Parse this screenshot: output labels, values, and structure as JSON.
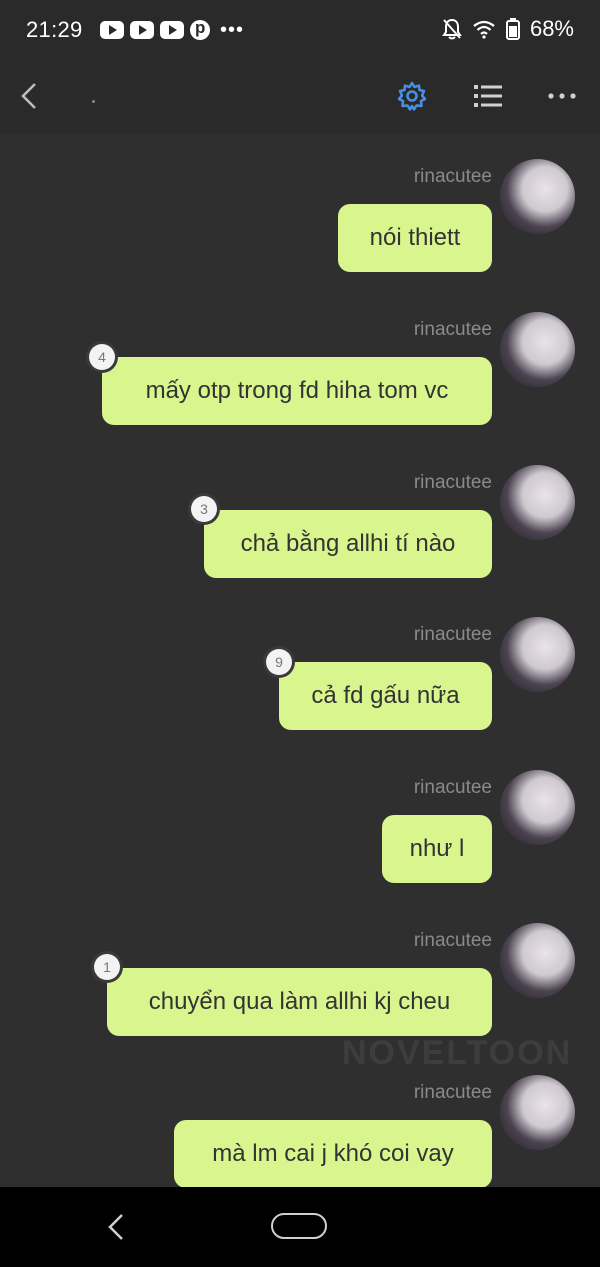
{
  "status_bar": {
    "time": "21:29",
    "battery": "68%",
    "notification_icons": [
      "youtube-icon",
      "youtube-icon",
      "youtube-icon",
      "pinterest-icon",
      "more-dots-icon"
    ],
    "right_icons": [
      "bell-muted-icon",
      "wifi-icon",
      "battery-icon"
    ]
  },
  "top_bar": {
    "icons": [
      "back-arrow-icon",
      "gear-icon",
      "list-icon",
      "more-horizontal-icon"
    ],
    "accent": "#4a90e2"
  },
  "messages": [
    {
      "sender": "rinacutee",
      "text": "nói thiett",
      "badge": ""
    },
    {
      "sender": "rinacutee",
      "text": "mấy otp trong fd hiha tom vc",
      "badge": "4"
    },
    {
      "sender": "rinacutee",
      "text": "chả bằng allhi tí nào",
      "badge": "3"
    },
    {
      "sender": "rinacutee",
      "text": "cả fd gấu nữa",
      "badge": "9"
    },
    {
      "sender": "rinacutee",
      "text": "như l",
      "badge": ""
    },
    {
      "sender": "rinacutee",
      "text": "chuyển qua làm allhi kj cheu",
      "badge": "1"
    },
    {
      "sender": "rinacutee",
      "text": "mà lm cai j khó coi vay",
      "badge": ""
    }
  ],
  "watermark": "NOVELTOON",
  "colors": {
    "bubble": "#d9f58d",
    "background": "#2f2f2f",
    "bar": "#2a2a2a"
  }
}
